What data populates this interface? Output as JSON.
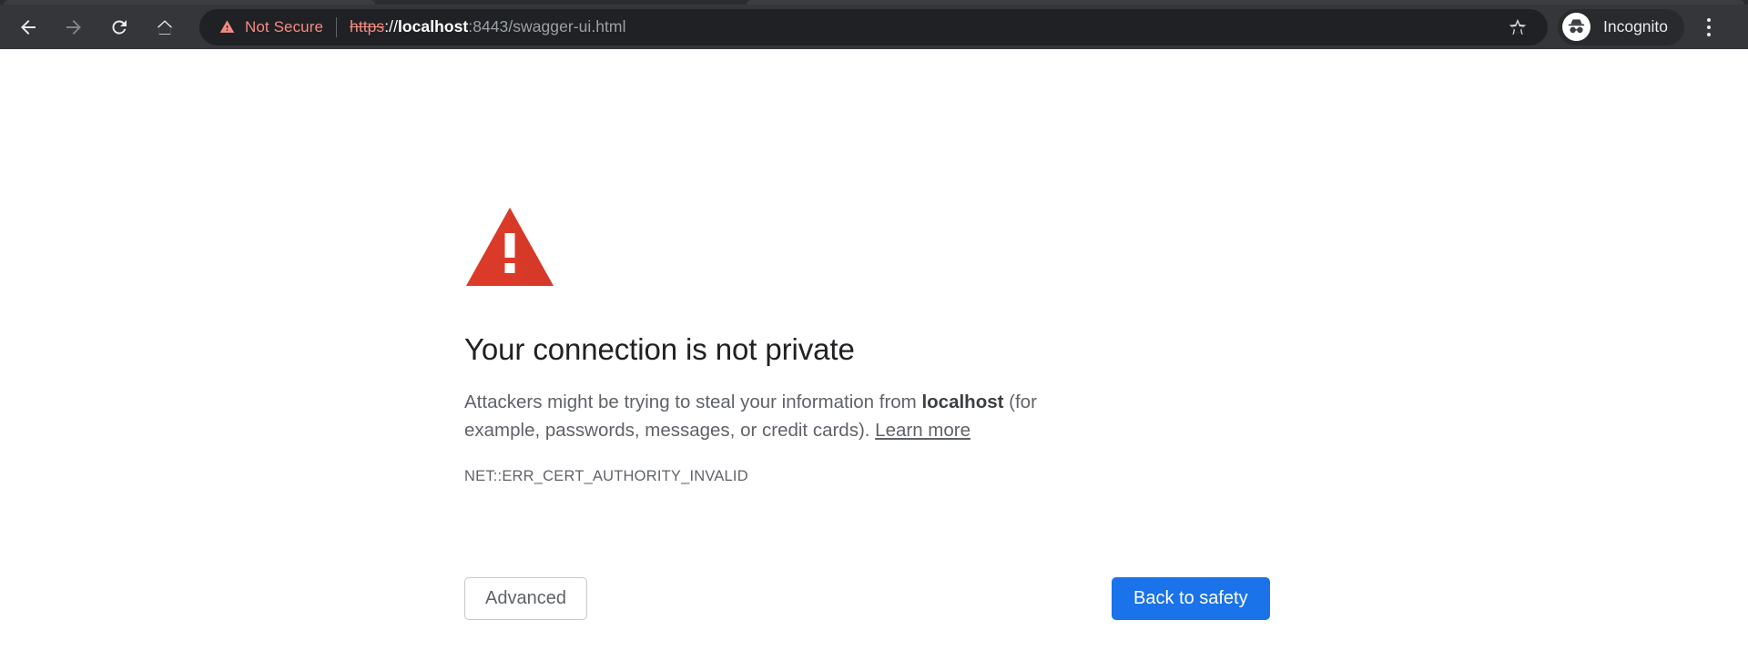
{
  "browser": {
    "nav": {
      "back_icon": "arrow-left-icon",
      "forward_icon": "arrow-right-icon",
      "reload_icon": "reload-icon",
      "home_icon": "home-icon"
    },
    "omnibox": {
      "security_icon": "warning-triangle-icon",
      "security_label": "Not Secure",
      "url_scheme": "https",
      "url_separator": "://",
      "url_host": "localhost",
      "url_rest": ":8443/swagger-ui.html",
      "full_url": "https://localhost:8443/swagger-ui.html",
      "bookmark_icon": "star-outline-icon"
    },
    "profile": {
      "avatar_icon": "incognito-hat-glasses-icon",
      "label": "Incognito"
    },
    "menu": {
      "icon": "three-dots-vertical-icon"
    },
    "colors": {
      "toolbar_bg": "#35363a",
      "omnibox_bg": "#202124",
      "warning_text": "#f28b82",
      "url_dim_text": "#9aa0a6"
    }
  },
  "interstitial": {
    "error_icon": "red-warning-triangle-icon",
    "title": "Your connection is not private",
    "paragraph": {
      "before_host": "Attackers might be trying to steal your information from ",
      "host": "localhost",
      "after_host": " (for example, passwords, messages, or credit cards). ",
      "learn_more": "Learn more"
    },
    "error_code": "NET::ERR_CERT_AUTHORITY_INVALID",
    "buttons": {
      "advanced": "Advanced",
      "back_to_safety": "Back to safety"
    },
    "colors": {
      "error_red": "#db3a28",
      "primary_button": "#1a73e8",
      "title_text": "#202124",
      "body_text": "#5f6368"
    }
  }
}
